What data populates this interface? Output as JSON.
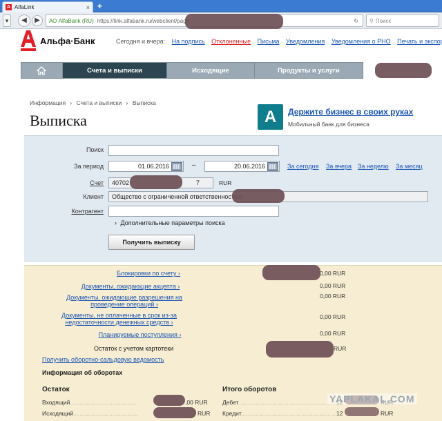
{
  "browser": {
    "tab_title": "AlfaLink",
    "tab_close": "×",
    "new_tab": "+",
    "url_site": "АО AlfaBank (RU)",
    "url": "https://link.alfabank.ru/webclient/page",
    "search_placeholder": "Поиск"
  },
  "header": {
    "bank_name": "Альфа·Банк",
    "today_label": "Сегодня и вчера:",
    "nav": [
      "На подпись",
      "Отклоненные",
      "Письма",
      "Уведомления",
      "Уведомления о РНО",
      "Печать и экспорт"
    ]
  },
  "menu": {
    "items": [
      "Счета и выписки",
      "Исходящие",
      "Продукты и услуги"
    ]
  },
  "breadcrumb": [
    "Информация",
    "Счета и выписки",
    "Выписка"
  ],
  "breadcrumb_sep": "›",
  "page_title": "Выписка",
  "promo": {
    "icon_letter": "А",
    "title": "Держите бизнес в своих руках",
    "subtitle": "Мобильный банк для бизнеса"
  },
  "search_form": {
    "search_label": "Поиск",
    "period_label": "За период",
    "date_from": "01.06.2016",
    "date_to": "20.06.2016",
    "dash": "–",
    "quick_links": [
      "За сегодня",
      "За вчера",
      "За неделю",
      "За месяц"
    ],
    "account_label": "Счет",
    "account_prefix": "40702",
    "account_suffix": "7",
    "currency": "RUR",
    "client_label": "Клиент",
    "client_value": "Общество с ограниченной ответственностью",
    "counterparty_label": "Контрагент",
    "more_params": "Дополнительные параметры поиска",
    "more_params_arrow": "›",
    "submit_label": "Получить выписку"
  },
  "balances": {
    "rows": [
      {
        "label": "Блокировки по счету",
        "value": "0,00 RUR"
      },
      {
        "label": "Документы, ожидающие акцепта",
        "value": "0,00 RUR"
      },
      {
        "label": "Документы, ожидающие разрешения на проведение операций",
        "value": "0,00 RUR"
      },
      {
        "label": "Документы, не оплаченные в срок из-за недостаточности денежных средств",
        "value": "0,00 RUR"
      },
      {
        "label": "Планируемые поступления",
        "value": "0,00 RUR"
      }
    ],
    "arrow": "›",
    "card_balance_label": "Остаток с учетом картотеки",
    "card_balance_value": "RUR",
    "osv_link": "Получить оборотно-сальдовую ведомость",
    "turnover_header": "Информация об оборотах",
    "rest_header": "Остаток",
    "incoming_label": "Входящий",
    "incoming_value": ",00 RUR",
    "outgoing_label": "Исходящий",
    "outgoing_value": "RUR",
    "totals_header": "Итого оборотов",
    "debit_label": "Дебет",
    "debit_value": "12",
    "debit_tail": "RUR",
    "credit_label": "Кредит",
    "credit_value": "12",
    "credit_tail": "RUR"
  },
  "watermark": "YAPLAKAL.COM",
  "colors": {
    "brand_red": "#e41e26",
    "menu_active": "#2d4551",
    "link": "#1c56b5",
    "promo_teal": "#107d8c"
  }
}
